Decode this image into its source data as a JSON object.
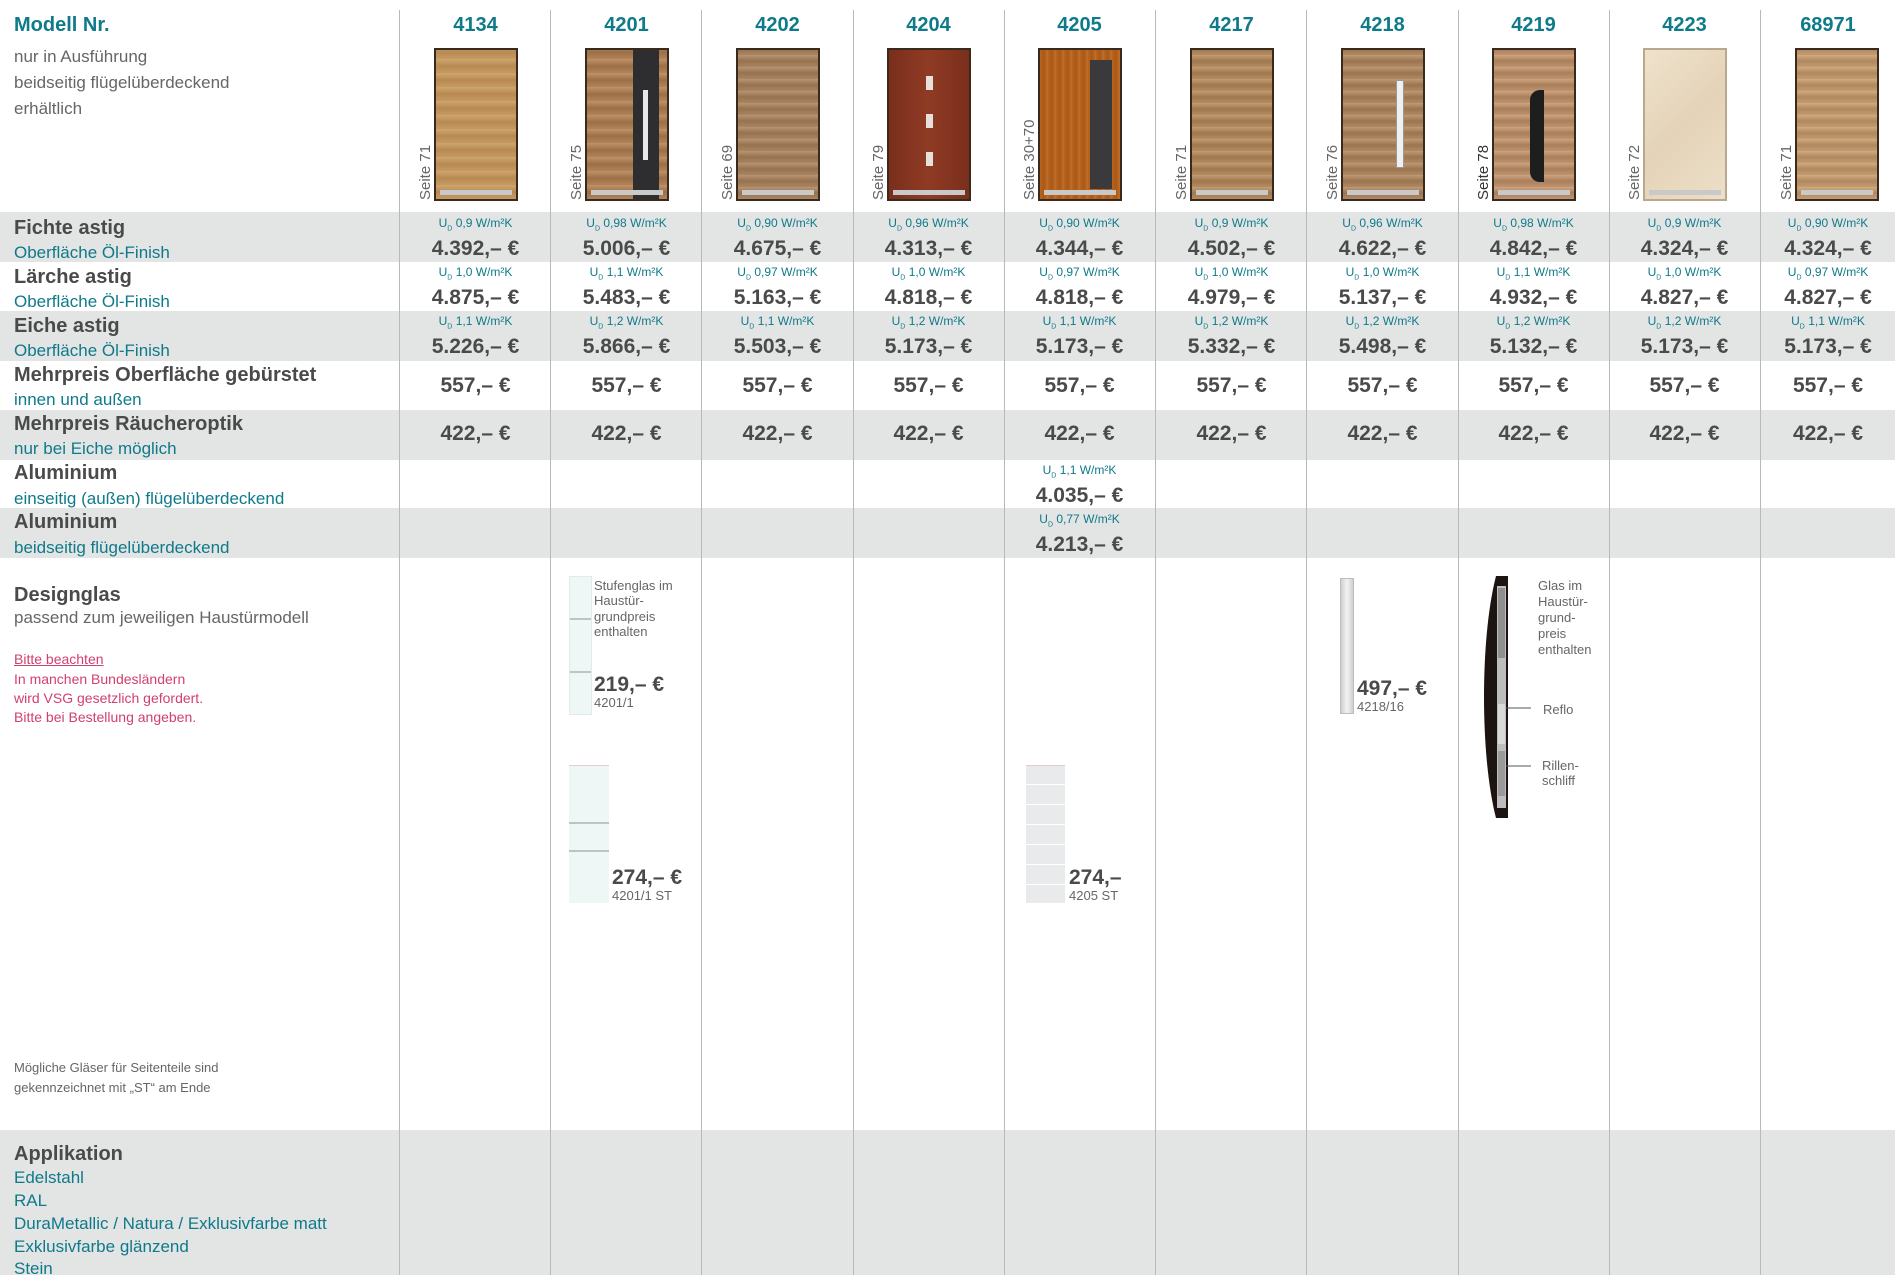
{
  "labels": {
    "modell": "Modell Nr.",
    "modell_note_1": "nur in Ausführung",
    "modell_note_2": "beidseitig flügelüberdeckend",
    "modell_note_3": "erhältlich",
    "fichte": "Fichte astig",
    "fichte_sub": "Oberfläche Öl-Finish",
    "laerche": "Lärche astig",
    "laerche_sub": "Oberfläche Öl-Finish",
    "eiche": "Eiche astig",
    "eiche_sub": "Oberfläche Öl-Finish",
    "buerstet": "Mehrpreis Oberfläche gebürstet",
    "buerstet_sub": "innen und außen",
    "raeucher": "Mehrpreis Räucheroptik",
    "raeucher_sub": "nur bei Eiche möglich",
    "alu1": "Aluminium",
    "alu1_sub": "einseitig (außen) flügelüberdeckend",
    "alu2": "Aluminium",
    "alu2_sub": "beidseitig flügelüberdeckend",
    "designglas": "Designglas",
    "designglas_sub": "passend zum jeweiligen Haustürmodell",
    "beachten": "Bitte beachten",
    "beachten_1": "In manchen Bundesländern",
    "beachten_2": "wird VSG gesetzlich gefordert.",
    "beachten_3": "Bitte bei Bestellung angeben.",
    "st_note_1": "Mögliche Gläser für Seitenteile sind",
    "st_note_2": "gekennzeichnet mit „ST“ am Ende",
    "applikation": "Applikation",
    "app_1": "Edelstahl",
    "app_2": "RAL",
    "app_3": "DuraMetallic / Natura / Exklusivfarbe matt",
    "app_4": "Exklusivfarbe glänzend",
    "app_5": "Stein"
  },
  "ud_unit": "W/m²K",
  "models": [
    {
      "nr": "4134",
      "seite": "Seite 71",
      "fichte_ud": "0,9",
      "fichte": "4.392,– €",
      "laerche_ud": "1,0",
      "laerche": "4.875,– €",
      "eiche_ud": "1,1",
      "eiche": "5.226,– €",
      "buerstet": "557,– €",
      "raeucher": "422,– €"
    },
    {
      "nr": "4201",
      "seite": "Seite 75",
      "fichte_ud": "0,98",
      "fichte": "5.006,– €",
      "laerche_ud": "1,1",
      "laerche": "5.483,– €",
      "eiche_ud": "1,2",
      "eiche": "5.866,– €",
      "buerstet": "557,– €",
      "raeucher": "422,– €"
    },
    {
      "nr": "4202",
      "seite": "Seite 69",
      "fichte_ud": "0,90",
      "fichte": "4.675,– €",
      "laerche_ud": "0,97",
      "laerche": "5.163,– €",
      "eiche_ud": "1,1",
      "eiche": "5.503,– €",
      "buerstet": "557,– €",
      "raeucher": "422,– €"
    },
    {
      "nr": "4204",
      "seite": "Seite 79",
      "fichte_ud": "0,96",
      "fichte": "4.313,– €",
      "laerche_ud": "1,0",
      "laerche": "4.818,– €",
      "eiche_ud": "1,2",
      "eiche": "5.173,– €",
      "buerstet": "557,– €",
      "raeucher": "422,– €"
    },
    {
      "nr": "4205",
      "seite": "Seite 30+70",
      "fichte_ud": "0,90",
      "fichte": "4.344,– €",
      "laerche_ud": "0,97",
      "laerche": "4.818,– €",
      "eiche_ud": "1,1",
      "eiche": "5.173,– €",
      "buerstet": "557,– €",
      "raeucher": "422,– €",
      "alu1_ud": "1,1",
      "alu1": "4.035,– €",
      "alu2_ud": "0,77",
      "alu2": "4.213,– €"
    },
    {
      "nr": "4217",
      "seite": "Seite 71",
      "fichte_ud": "0,9",
      "fichte": "4.502,– €",
      "laerche_ud": "1,0",
      "laerche": "4.979,– €",
      "eiche_ud": "1,2",
      "eiche": "5.332,– €",
      "buerstet": "557,– €",
      "raeucher": "422,– €"
    },
    {
      "nr": "4218",
      "seite": "Seite 76",
      "fichte_ud": "0,96",
      "fichte": "4.622,– €",
      "laerche_ud": "1,0",
      "laerche": "5.137,– €",
      "eiche_ud": "1,2",
      "eiche": "5.498,– €",
      "buerstet": "557,– €",
      "raeucher": "422,– €"
    },
    {
      "nr": "4219",
      "seite": "Seite 78",
      "fichte_ud": "0,98",
      "fichte": "4.842,– €",
      "laerche_ud": "1,1",
      "laerche": "4.932,– €",
      "eiche_ud": "1,2",
      "eiche": "5.132,– €",
      "buerstet": "557,– €",
      "raeucher": "422,– €"
    },
    {
      "nr": "4223",
      "seite": "Seite 72",
      "fichte_ud": "0,9",
      "fichte": "4.324,– €",
      "laerche_ud": "1,0",
      "laerche": "4.827,– €",
      "eiche_ud": "1,2",
      "eiche": "5.173,– €",
      "buerstet": "557,– €",
      "raeucher": "422,– €"
    },
    {
      "nr": "68971",
      "seite": "Seite 71",
      "fichte_ud": "0,90",
      "fichte": "4.324,– €",
      "laerche_ud": "0,97",
      "laerche": "4.827,– €",
      "eiche_ud": "1,1",
      "eiche": "5.173,– €",
      "buerstet": "557,– €",
      "raeucher": "422,– €"
    }
  ],
  "glasses": {
    "g4201_note_1": "Stufenglas im",
    "g4201_note_2": "Haustür-",
    "g4201_note_3": "grundpreis",
    "g4201_note_4": "enthalten",
    "g4201_price": "219,– €",
    "g4201_code": "4201/1",
    "g4201st_price": "274,– €",
    "g4201st_code": "4201/1 ST",
    "g4205st_price": "274,–",
    "g4205st_code": "4205 ST",
    "g4218_price": "497,– €",
    "g4218_code": "4218/16",
    "g4219_note_1": "Glas im",
    "g4219_note_2": "Haustür-",
    "g4219_note_3": "grund-",
    "g4219_note_4": "preis",
    "g4219_note_5": "enthalten",
    "g4219_reflo": "Reflo",
    "g4219_rillen_1": "Rillen-",
    "g4219_rillen_2": "schliff"
  },
  "colors": {
    "teal": "#0e7a8a",
    "band": "#e3e4e4",
    "pink": "#d2406d"
  }
}
